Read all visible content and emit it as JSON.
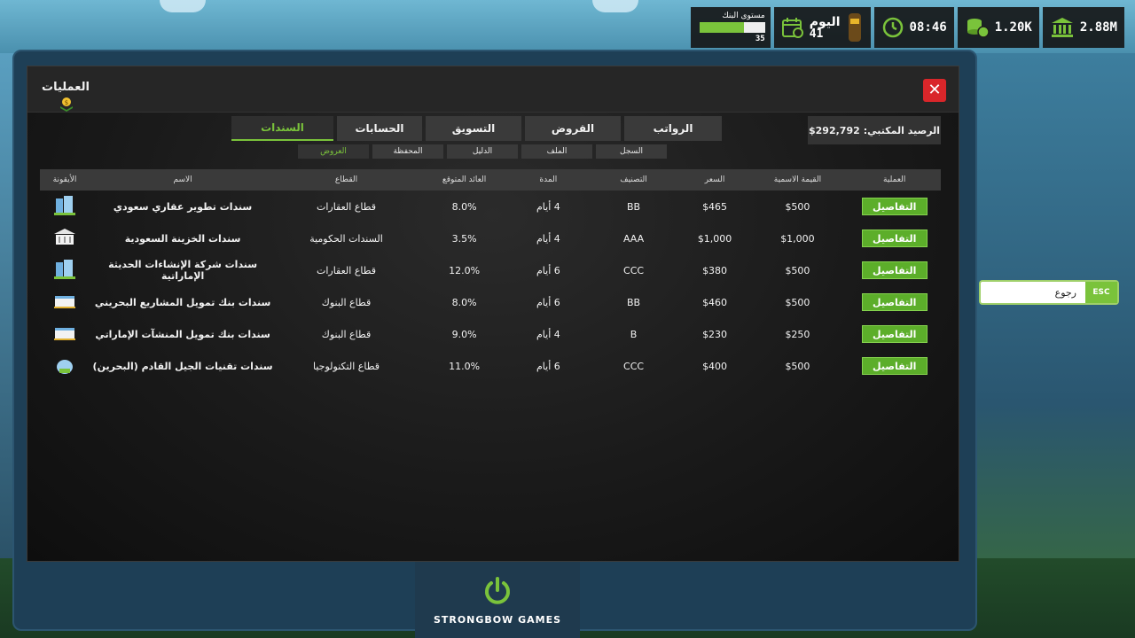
{
  "hud": {
    "bank_level_label": "مستوى البنك",
    "bank_level_value": "35",
    "bank_level_progress": 0.68,
    "day_label": "اليوم",
    "day_value": "41",
    "time": "08:46",
    "cash": "1.20K",
    "bank_balance": "2.88M"
  },
  "window": {
    "title": "العمليات",
    "close_label": "✕"
  },
  "balance": {
    "label": "الرصيد المكتبي:",
    "value": "$292,792"
  },
  "tabs": [
    {
      "label": "الرواتب"
    },
    {
      "label": "القروض"
    },
    {
      "label": "التسويق"
    },
    {
      "label": "الحسابات"
    },
    {
      "label": "السندات"
    }
  ],
  "subtabs": [
    {
      "label": "السجل"
    },
    {
      "label": "الملف"
    },
    {
      "label": "الدليل"
    },
    {
      "label": "المحفظة"
    },
    {
      "label": "العروض"
    }
  ],
  "table": {
    "headers": {
      "operation": "العملية",
      "face_value": "القيمة الاسمية",
      "price": "السعر",
      "rating": "التصنيف",
      "duration": "المدة",
      "yield": "العائد المتوقع",
      "sector": "القطاع",
      "name": "الاسم",
      "icon": "الأيقونة"
    },
    "details_label": "التفاصيل",
    "rows": [
      {
        "name": "سندات تطوير عقاري سعودي",
        "sector": "قطاع العقارات",
        "yield": "8.0%",
        "duration": "4 أيام",
        "rating": "BB",
        "price": "$465",
        "face": "$500",
        "icon": "building-icon"
      },
      {
        "name": "سندات الخزينة السعودية",
        "sector": "السندات الحكومية",
        "yield": "3.5%",
        "duration": "4 أيام",
        "rating": "AAA",
        "price": "$1,000",
        "face": "$1,000",
        "icon": "government-icon"
      },
      {
        "name": "سندات شركة الإنشاءات الحديثة الإماراتية",
        "sector": "قطاع العقارات",
        "yield": "12.0%",
        "duration": "6 أيام",
        "rating": "CCC",
        "price": "$380",
        "face": "$500",
        "icon": "building-icon"
      },
      {
        "name": "سندات بنك تمويل المشاريع البحريني",
        "sector": "قطاع البنوك",
        "yield": "8.0%",
        "duration": "6 أيام",
        "rating": "BB",
        "price": "$460",
        "face": "$500",
        "icon": "bank-icon"
      },
      {
        "name": "سندات بنك تمويل المنشآت الإماراتي",
        "sector": "قطاع البنوك",
        "yield": "9.0%",
        "duration": "4 أيام",
        "rating": "B",
        "price": "$230",
        "face": "$250",
        "icon": "bank-icon"
      },
      {
        "name": "سندات تقنيات الجيل القادم (البحرين)",
        "sector": "قطاع التكنولوجيا",
        "yield": "11.0%",
        "duration": "6 أيام",
        "rating": "CCC",
        "price": "$400",
        "face": "$500",
        "icon": "tech-icon"
      }
    ]
  },
  "power": {
    "label": "STRONGBOW GAMES"
  },
  "esc": {
    "key": "ESC",
    "label": "رجوع"
  },
  "colors": {
    "accent": "#7ac33b",
    "close": "#d9262a"
  }
}
